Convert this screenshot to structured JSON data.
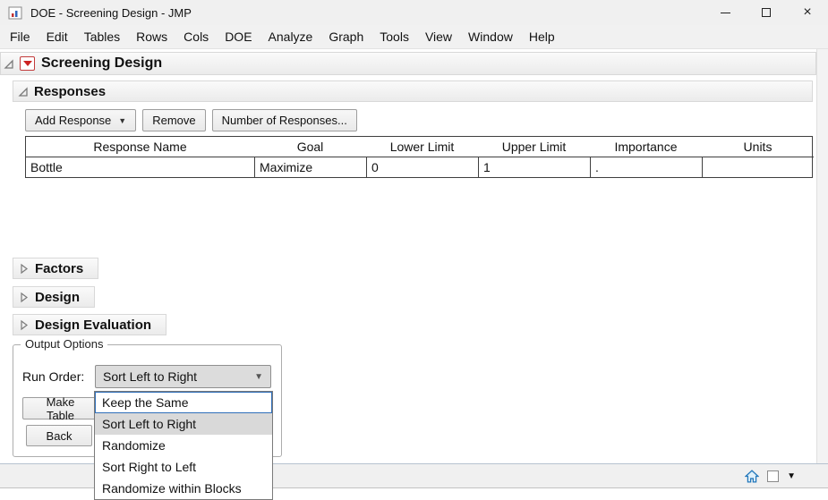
{
  "window": {
    "title": "DOE - Screening Design - JMP"
  },
  "menubar": {
    "items": [
      "File",
      "Edit",
      "Tables",
      "Rows",
      "Cols",
      "DOE",
      "Analyze",
      "Graph",
      "Tools",
      "View",
      "Window",
      "Help"
    ]
  },
  "outline": {
    "root_title": "Screening Design",
    "responses_title": "Responses",
    "collapsed_sections": [
      "Factors",
      "Design",
      "Design Evaluation"
    ]
  },
  "responses": {
    "buttons": {
      "add_response": "Add Response",
      "remove": "Remove",
      "number_of_responses": "Number of Responses..."
    },
    "table": {
      "headers": [
        "Response Name",
        "Goal",
        "Lower Limit",
        "Upper Limit",
        "Importance",
        "Units"
      ],
      "rows": [
        [
          "Bottle",
          "Maximize",
          "0",
          "1",
          ".",
          ""
        ]
      ]
    }
  },
  "output_options": {
    "title": "Output Options",
    "run_order_label": "Run Order:",
    "run_order_value": "Sort Left to Right",
    "make_table": "Make Table",
    "back": "Back"
  },
  "dropdown": {
    "options": [
      "Keep the Same",
      "Sort Left to Right",
      "Randomize",
      "Sort Right to Left",
      "Randomize within Blocks"
    ],
    "focused_option": "Keep the Same",
    "selected_option": "Sort Left to Right"
  },
  "icons": {
    "app": "jmp-document-icon",
    "window_controls": [
      "minimize-icon",
      "maximize-icon",
      "close-icon"
    ],
    "red_triangle": "red-triangle-menu-icon",
    "statusbar": [
      "home-icon",
      "window-box-icon",
      "caret-down-icon"
    ]
  },
  "colors": {
    "focus_blue": "#2f6fba",
    "red_triangle": "#cc2222",
    "selection_gray": "#d9d9d9"
  }
}
